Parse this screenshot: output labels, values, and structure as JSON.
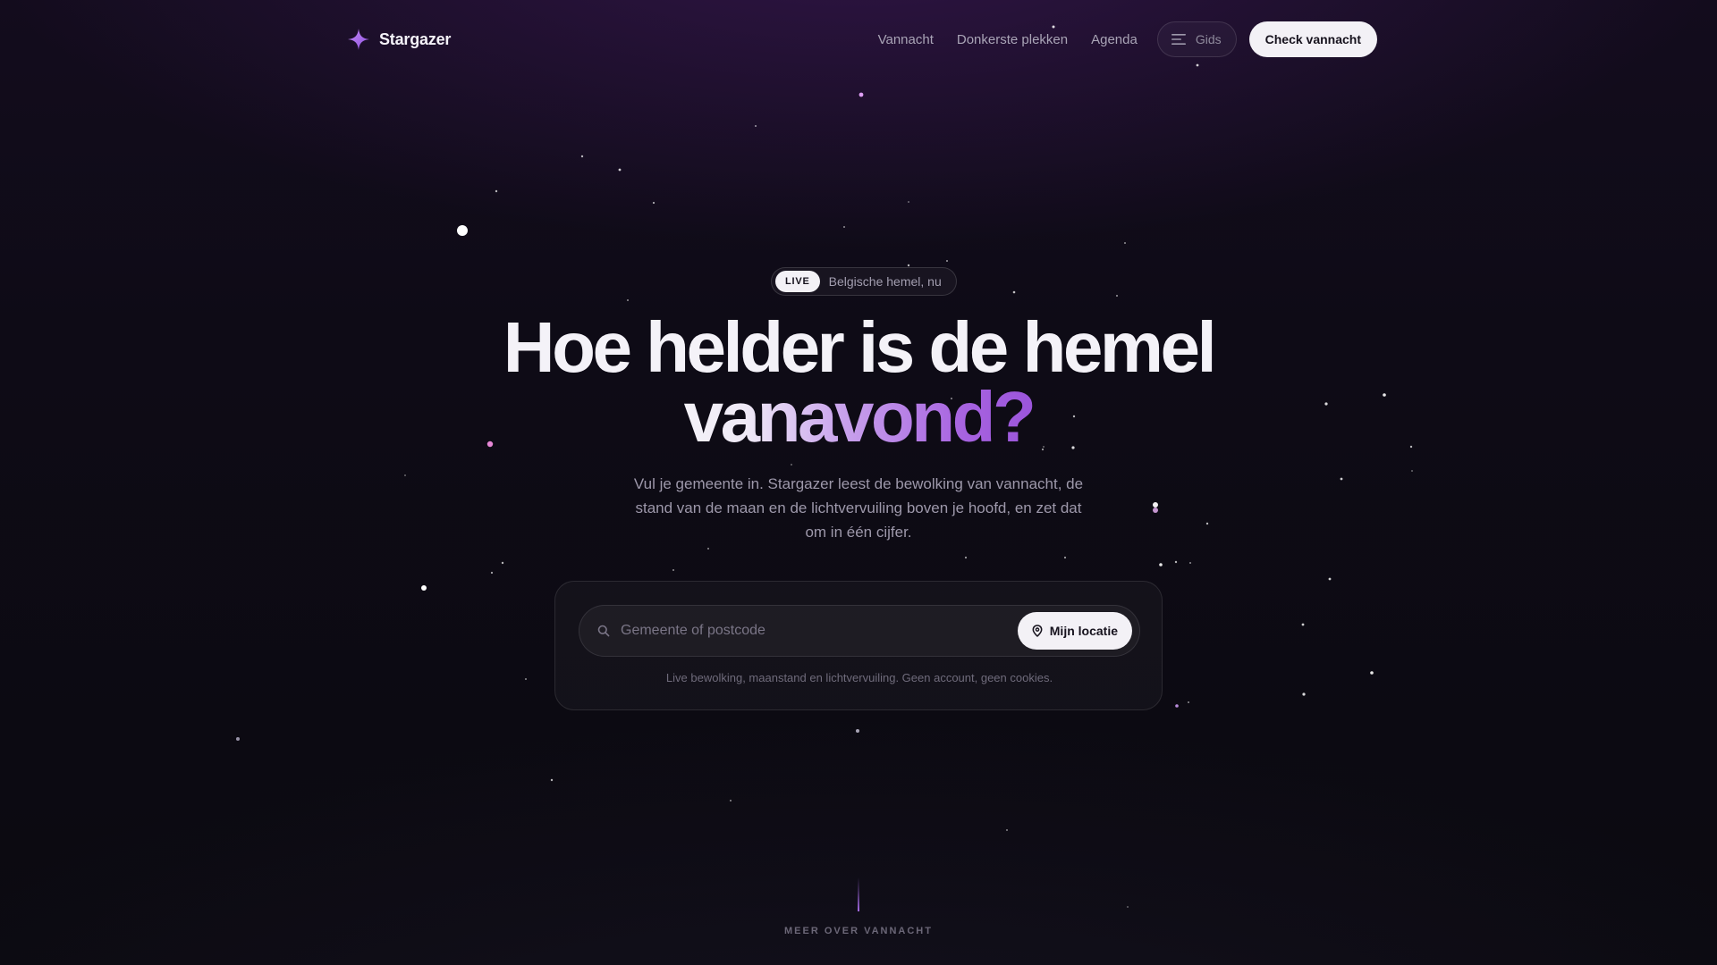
{
  "header": {
    "brand_name": "Stargazer",
    "brand_icon": "sparkle-icon",
    "nav": [
      "Vannacht",
      "Donkerste plekken",
      "Agenda"
    ],
    "guide_label": "Gids",
    "guide_icon": "menu-icon",
    "cta_label": "Check vannacht"
  },
  "hero": {
    "live_badge": "LIVE",
    "live_text": "Belgische hemel, nu",
    "headline_line1": "Hoe helder is de hemel",
    "headline_line2": "vanavond?",
    "subtitle": "Vul je gemeente in. Stargazer leest de bewolking van vannacht, de stand van de maan en de lichtvervuiling boven je hoofd, en zet dat om in één cijfer."
  },
  "search": {
    "placeholder": "Gemeente of postcode",
    "value": "",
    "search_icon": "search-icon",
    "location_label": "Mijn locatie",
    "location_icon": "pin-icon",
    "note": "Live bewolking, maanstand en lichtvervuiling. Geen account, geen cookies."
  },
  "scroll_hint": "MEER OVER VANNACHT",
  "colors": {
    "background": "#0c0a12",
    "accent": "#a763e0",
    "button_bg": "#f3f1f6",
    "text_primary": "#f4f2f8",
    "text_muted": "#9d98aa"
  }
}
